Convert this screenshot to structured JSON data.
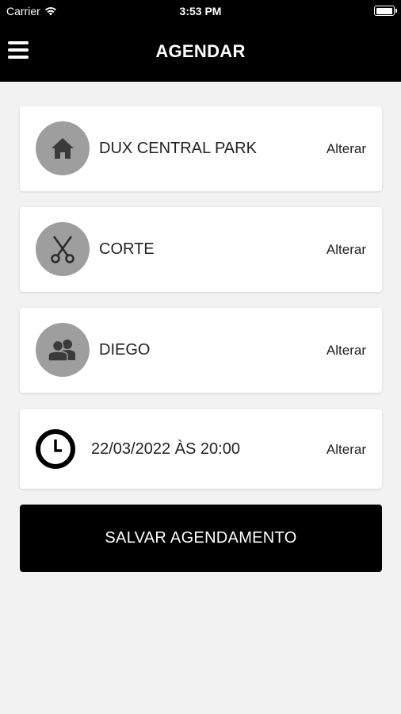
{
  "status_bar": {
    "carrier": "Carrier",
    "time": "3:53 PM"
  },
  "header": {
    "title": "AGENDAR"
  },
  "items": [
    {
      "label": "DUX CENTRAL PARK",
      "action": "Alterar",
      "icon": "home-icon"
    },
    {
      "label": "CORTE",
      "action": "Alterar",
      "icon": "scissors-icon"
    },
    {
      "label": "DIEGO",
      "action": "Alterar",
      "icon": "users-icon"
    },
    {
      "label": "22/03/2022 ÀS 20:00",
      "action": "Alterar",
      "icon": "clock-icon"
    }
  ],
  "save_button": {
    "label": "SALVAR AGENDAMENTO"
  },
  "colors": {
    "header_bg": "#000000",
    "page_bg": "#f2f2f2",
    "icon_circle": "#9e9e9e",
    "button_bg": "#000000"
  }
}
